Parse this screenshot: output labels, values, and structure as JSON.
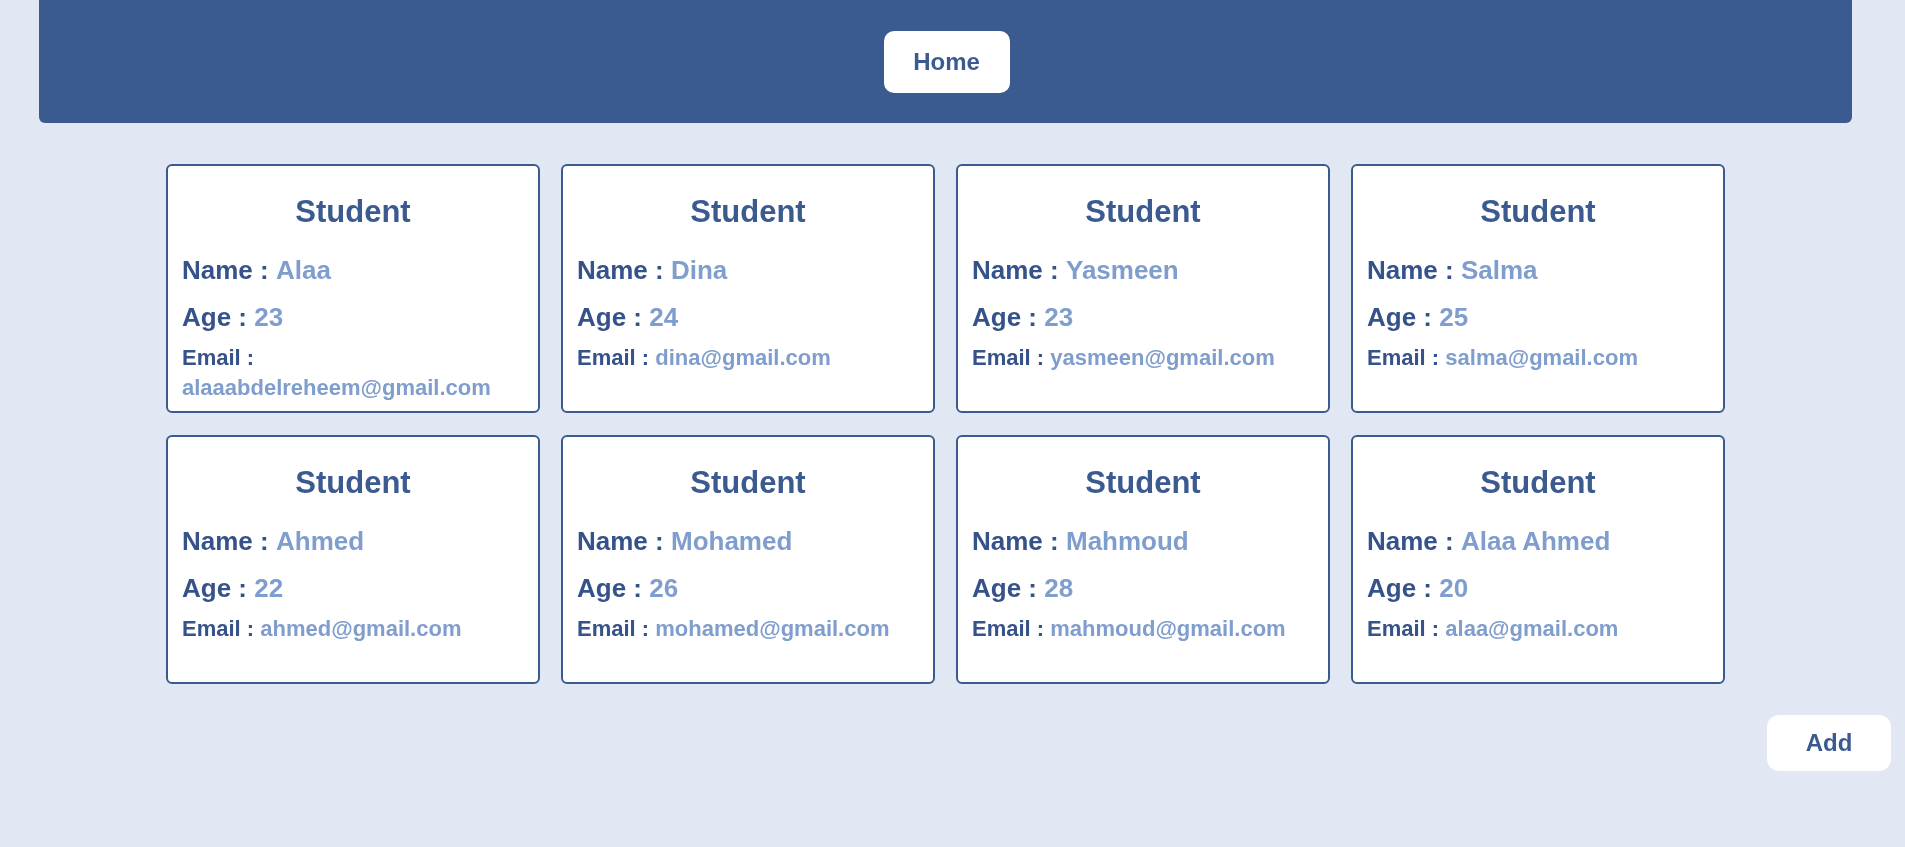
{
  "header": {
    "nav_button": "Home"
  },
  "students": [
    {
      "title": "Student",
      "name_label": "Name :",
      "name": "Alaa",
      "age_label": "Age :",
      "age": "23",
      "email_label": "Email :",
      "email": "alaaabdelreheem@gmail.com"
    },
    {
      "title": "Student",
      "name_label": "Name :",
      "name": "Dina",
      "age_label": "Age :",
      "age": "24",
      "email_label": "Email :",
      "email": "dina@gmail.com"
    },
    {
      "title": "Student",
      "name_label": "Name :",
      "name": "Yasmeen",
      "age_label": "Age :",
      "age": "23",
      "email_label": "Email :",
      "email": "yasmeen@gmail.com"
    },
    {
      "title": "Student",
      "name_label": "Name :",
      "name": "Salma",
      "age_label": "Age :",
      "age": "25",
      "email_label": "Email :",
      "email": "salma@gmail.com"
    },
    {
      "title": "Student",
      "name_label": "Name :",
      "name": "Ahmed",
      "age_label": "Age :",
      "age": "22",
      "email_label": "Email :",
      "email": "ahmed@gmail.com"
    },
    {
      "title": "Student",
      "name_label": "Name :",
      "name": "Mohamed",
      "age_label": "Age :",
      "age": "26",
      "email_label": "Email :",
      "email": "mohamed@gmail.com"
    },
    {
      "title": "Student",
      "name_label": "Name :",
      "name": "Mahmoud",
      "age_label": "Age :",
      "age": "28",
      "email_label": "Email :",
      "email": "mahmoud@gmail.com"
    },
    {
      "title": "Student",
      "name_label": "Name :",
      "name": "Alaa Ahmed",
      "age_label": "Age :",
      "age": "20",
      "email_label": "Email :",
      "email": "alaa@gmail.com"
    }
  ],
  "add_button": "Add"
}
